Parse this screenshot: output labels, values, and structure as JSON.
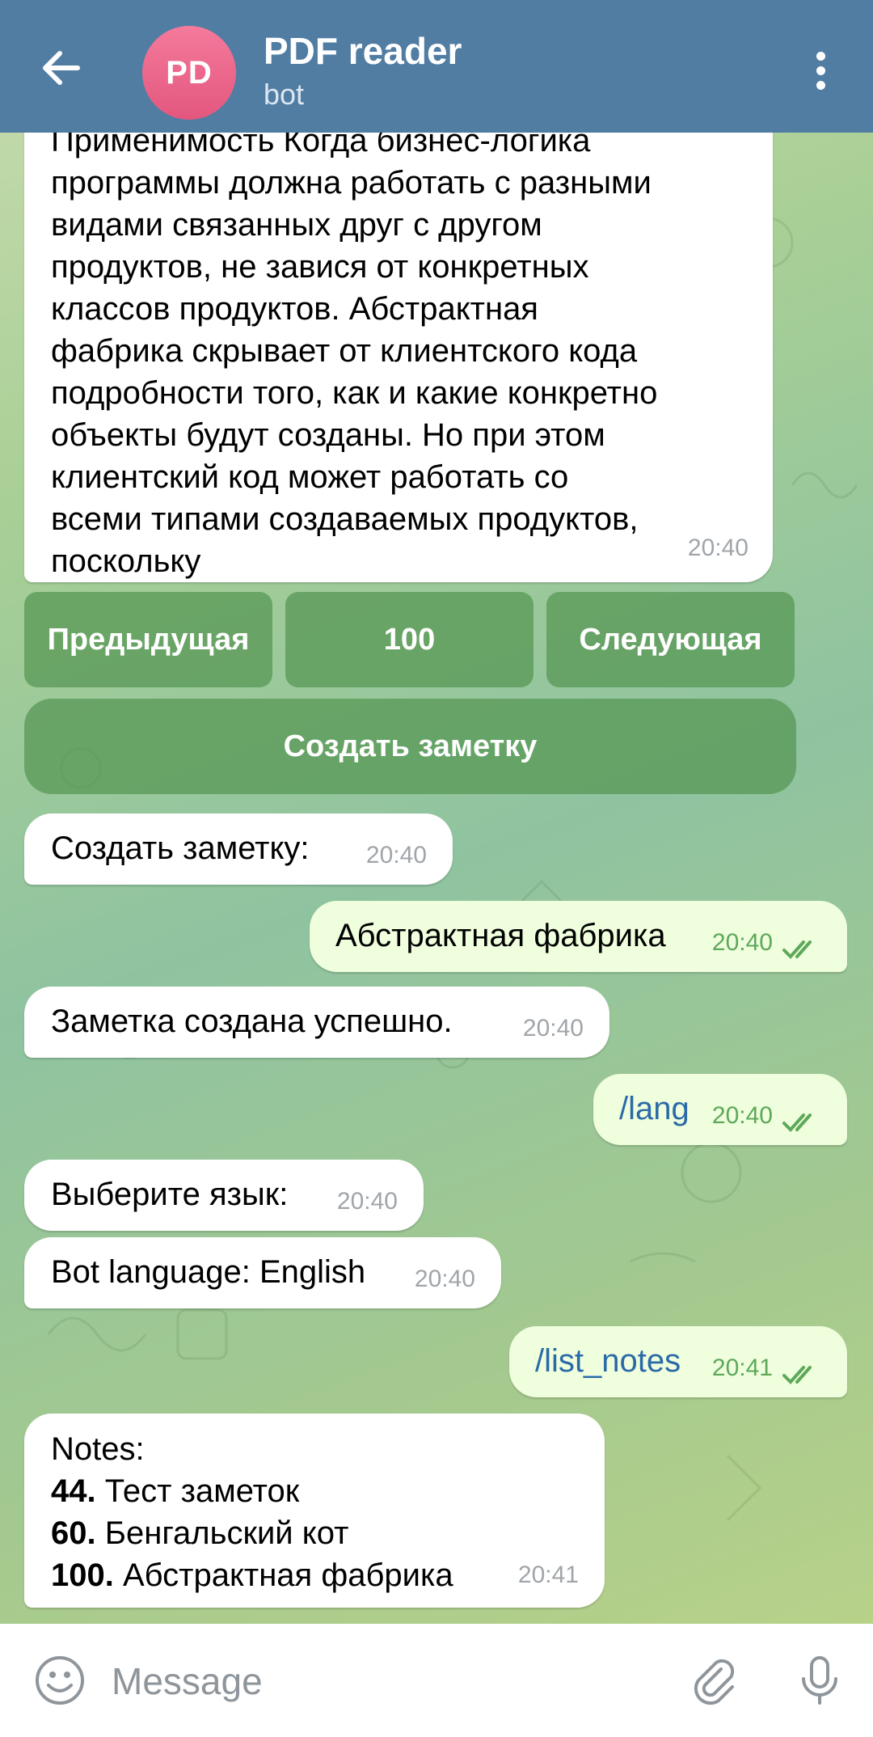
{
  "header": {
    "avatar_initials": "PD",
    "title": "PDF reader",
    "subtitle": "bot"
  },
  "messages": {
    "page_text": {
      "lines": [
        "Применимость Когда бизнес-логика",
        "программы должна работать с разными",
        "видами связанных друг с другом",
        "продуктов, не завися от конкретных",
        "классов продуктов. Абстрактная",
        "фабрика скрывает от клиентского кода",
        "подробности того, как и какие конкретно",
        "объекты будут созданы. Но при этом",
        "клиентский код может работать со",
        "всеми типами создаваемых продуктов,",
        "поскольку"
      ],
      "time": "20:40"
    },
    "create_note_prompt": {
      "text": "Создать заметку:",
      "time": "20:40"
    },
    "note_title_sent": {
      "text": "Абстрактная фабрика",
      "time": "20:40"
    },
    "note_created": {
      "text": "Заметка создана успешно.",
      "time": "20:40"
    },
    "lang_cmd": {
      "text": "/lang",
      "time": "20:40"
    },
    "choose_lang": {
      "text": "Выберите язык:",
      "time": "20:40"
    },
    "bot_lang": {
      "text": "Bot language: English",
      "time": "20:40"
    },
    "list_notes_cmd": {
      "text": "/list_notes",
      "time": "20:41"
    },
    "notes_list": {
      "header": "Notes:",
      "items": [
        {
          "num": "44.",
          "title": "Тест заметок"
        },
        {
          "num": "60.",
          "title": "Бенгальский кот"
        },
        {
          "num": "100.",
          "title": "Абстрактная фабрика"
        }
      ],
      "time": "20:41"
    }
  },
  "keyboard": {
    "prev": "Предыдущая",
    "page": "100",
    "next": "Следующая",
    "create_note": "Создать заметку"
  },
  "input": {
    "placeholder": "Message"
  },
  "colors": {
    "header_bg": "#527da3",
    "outgoing_bg": "#effedd",
    "incoming_bg": "#ffffff",
    "command_link": "#2b6aa8",
    "read_checks": "#5ea85a"
  }
}
